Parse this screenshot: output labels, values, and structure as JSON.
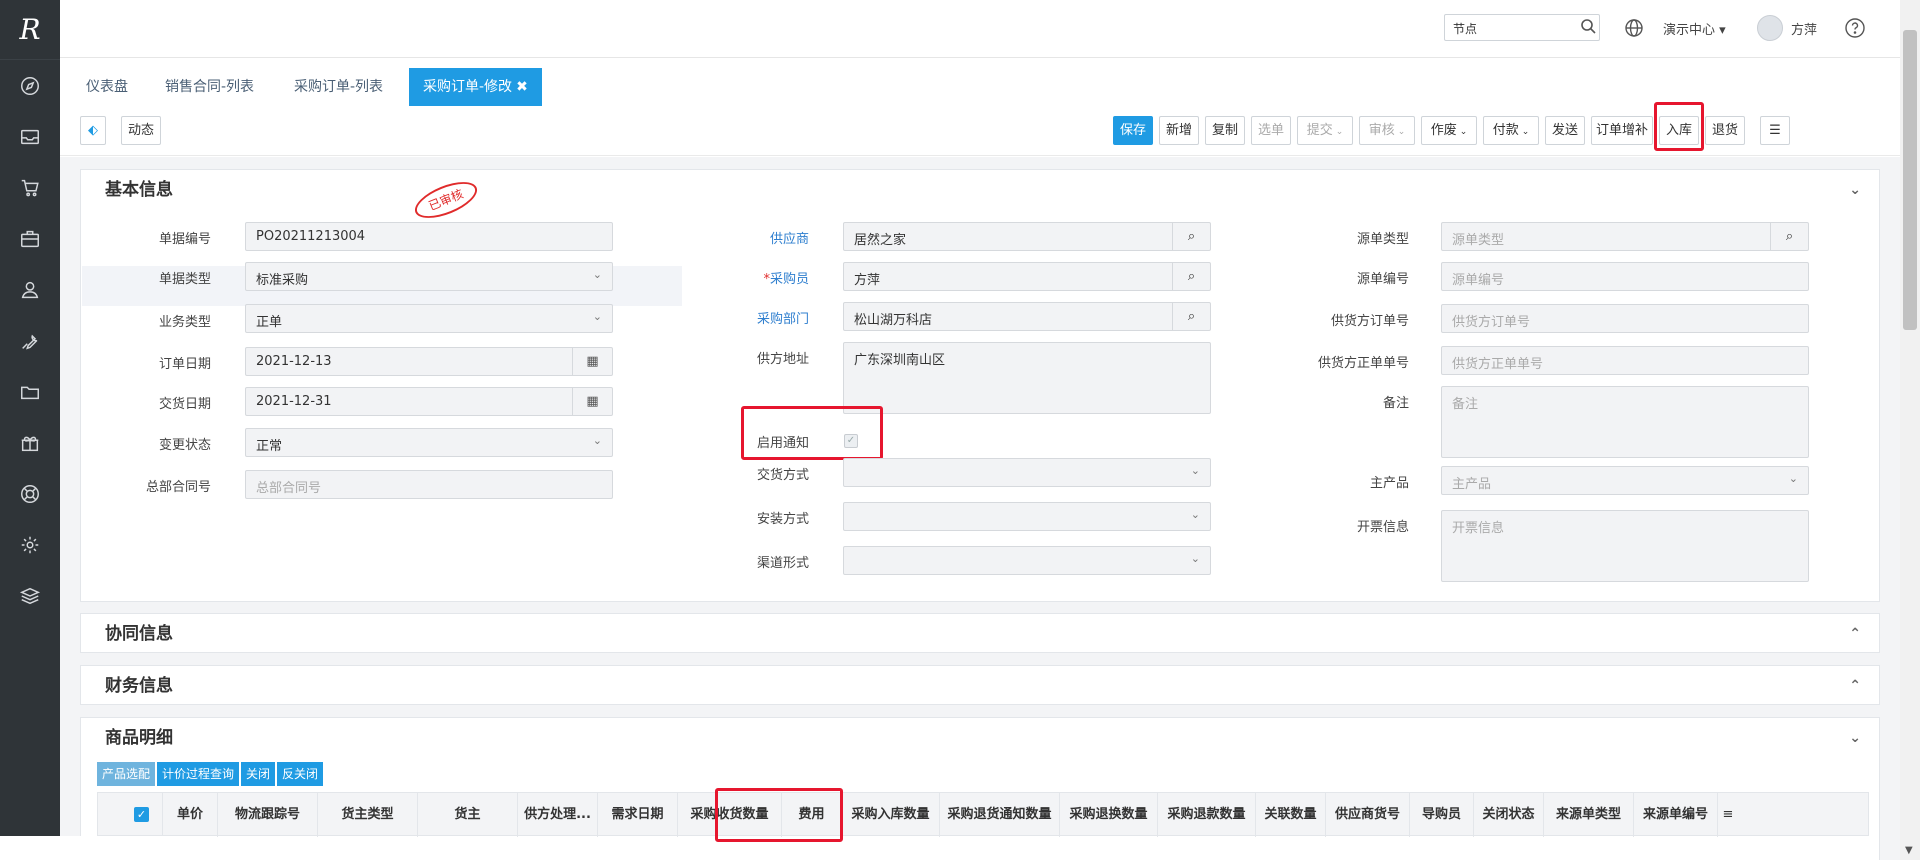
{
  "brand": {
    "logo": "R"
  },
  "sidebar": {
    "items": [
      {
        "icon": "compass-icon"
      },
      {
        "icon": "inbox-icon"
      },
      {
        "icon": "cart-icon"
      },
      {
        "icon": "briefcase-icon"
      },
      {
        "icon": "user-icon"
      },
      {
        "icon": "wrench-icon"
      },
      {
        "icon": "folder-icon"
      },
      {
        "icon": "gift-icon"
      },
      {
        "icon": "lifebuoy-icon"
      },
      {
        "icon": "gear-icon"
      },
      {
        "icon": "layers-icon"
      }
    ]
  },
  "topbar": {
    "search_value": "节点",
    "center": "演示中心",
    "user": "方萍"
  },
  "tabs": [
    {
      "label": "仪表盘"
    },
    {
      "label": "销售合同-列表"
    },
    {
      "label": "采购订单-列表"
    },
    {
      "label": "采购订单-修改",
      "close": "✖"
    }
  ],
  "toolbar": {
    "activity_label": "动态",
    "buttons": {
      "save": "保存",
      "add": "新增",
      "copy": "复制",
      "select": "选单",
      "submit": "提交",
      "audit": "审核",
      "void": "作废",
      "pay": "付款",
      "send": "发送",
      "supplement": "订单增补",
      "stock_in": "入库",
      "return": "退货"
    }
  },
  "basic": {
    "title": "基本信息",
    "stamp": "已审核",
    "left": {
      "doc_no_label": "单据编号",
      "doc_no": "PO20211213004",
      "doc_type_label": "单据类型",
      "doc_type": "标准采购",
      "biz_type_label": "业务类型",
      "biz_type": "正单",
      "order_date_label": "订单日期",
      "order_date": "2021-12-13",
      "delivery_date_label": "交货日期",
      "delivery_date": "2021-12-31",
      "change_status_label": "变更状态",
      "change_status": "正常",
      "master_contract_label": "总部合同号",
      "master_contract_ph": "总部合同号"
    },
    "middle": {
      "supplier_label": "供应商",
      "supplier": "居然之家",
      "buyer_label": "采购员",
      "buyer_req": "*",
      "buyer": "方萍",
      "dept_label": "采购部门",
      "dept": "松山湖万科店",
      "address_label": "供方地址",
      "address": "广东深圳南山区",
      "notify_label": "启用通知",
      "notify_check": "✓",
      "delivery_mode_label": "交货方式",
      "install_mode_label": "安装方式",
      "channel_label": "渠道形式"
    },
    "right": {
      "src_type_label": "源单类型",
      "src_type_ph": "源单类型",
      "src_no_label": "源单编号",
      "src_no_ph": "源单编号",
      "supplier_order_label": "供货方订单号",
      "supplier_order_ph": "供货方订单号",
      "supplier_pos_label": "供货方正单单号",
      "supplier_pos_ph": "供货方正单单号",
      "remark_label": "备注",
      "remark_ph": "备注",
      "main_product_label": "主产品",
      "main_product_ph": "主产品",
      "invoice_label": "开票信息",
      "invoice_ph": "开票信息"
    }
  },
  "collab": {
    "title": "协同信息"
  },
  "finance": {
    "title": "财务信息"
  },
  "products": {
    "title": "商品明细",
    "buttons": [
      "产品选配",
      "计价过程查询",
      "关闭",
      "反关闭"
    ],
    "columns": [
      "单价",
      "物流跟踪号",
      "货主类型",
      "货主",
      "供方处理...",
      "需求日期",
      "采购收货数量",
      "费用",
      "采购入库数量",
      "采购退货通知数量",
      "采购退换数量",
      "采购退款数量",
      "关联数量",
      "供应商货号",
      "导购员",
      "关闭状态",
      "来源单类型",
      "来源单编号"
    ]
  }
}
